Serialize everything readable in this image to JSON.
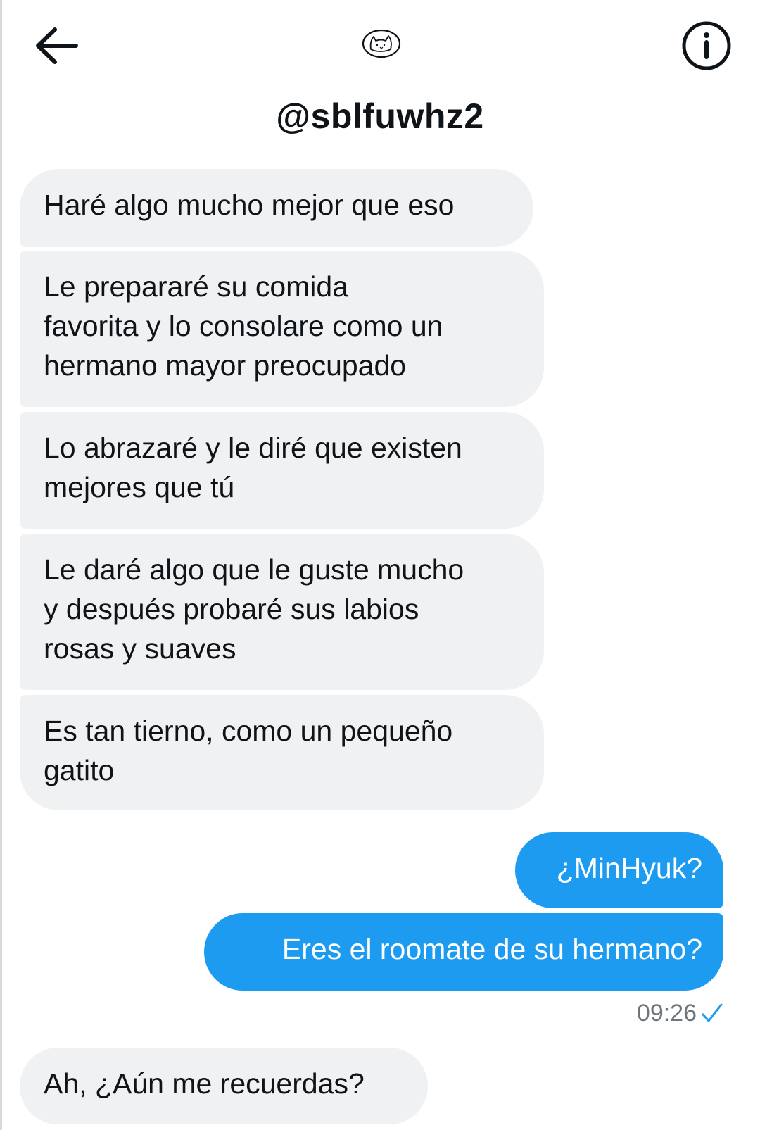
{
  "header": {
    "title": "@sblfuwhz2",
    "back_icon": "arrow-left-icon",
    "avatar_icon": "cat-doodle-icon",
    "info_icon": "info-circle-icon"
  },
  "messages": [
    {
      "direction": "received",
      "text": "Haré algo mucho mejor que eso"
    },
    {
      "direction": "received",
      "lines": [
        "Le prepararé su comida",
        "favorita y lo consolare como un",
        "hermano mayor preocupado"
      ]
    },
    {
      "direction": "received",
      "lines": [
        "Lo abrazaré y le diré que existen",
        "mejores que tú"
      ]
    },
    {
      "direction": "received",
      "lines": [
        "Le daré algo que le guste mucho",
        "y después probaré sus labios",
        "rosas y suaves"
      ]
    },
    {
      "direction": "received",
      "lines": [
        "Es tan tierno, como un pequeño",
        "gatito"
      ]
    },
    {
      "direction": "sent",
      "text": "¿MinHyuk?"
    },
    {
      "direction": "sent",
      "text": "Eres el roomate de su hermano?"
    },
    {
      "direction": "received",
      "text": "Ah, ¿Aún me recuerdas?"
    }
  ],
  "sent_meta": {
    "time": "09:26",
    "status_icon": "checkmark-icon"
  },
  "colors": {
    "sent_bubble": "#1d9bf0",
    "received_bubble": "#eff1f3",
    "text": "#0f1419",
    "muted": "#6e767d"
  }
}
